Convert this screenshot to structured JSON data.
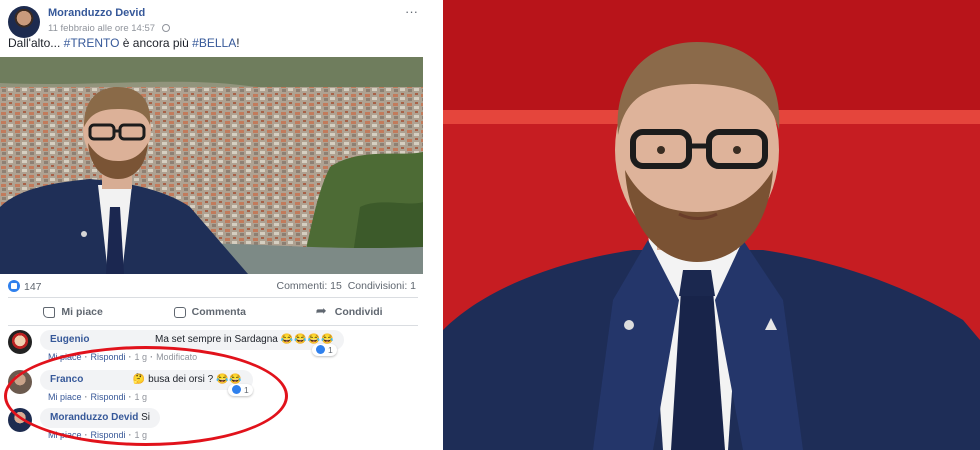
{
  "post": {
    "author": "Moranduzzo Devid",
    "timestamp": "11 febbraio alle ore 14:57",
    "more_icon": "···",
    "text_prefix": "Dall'alto... ",
    "tag_trento": "#TRENTO",
    "text_middle": " è ancora più ",
    "tag_bella": "#BELLA",
    "text_suffix": "!",
    "reactions_count": "147",
    "comments_count": "Commenti: 15",
    "shares_count": "Condivisioni: 1",
    "actions": {
      "like": "Mi piace",
      "comment": "Commenta",
      "share": "Condividi"
    }
  },
  "comments": [
    {
      "name": "Eugenio",
      "text": "Ma set sempre in Sardagna",
      "emojis": "😂😂😂😂",
      "like_label": "Mi piace",
      "reply_label": "Rispondi",
      "time": "1 g",
      "edit_label": "Modificato",
      "reaction_count": "1"
    },
    {
      "name": "Franco",
      "text": "busa dei orsi ?",
      "emoji_prefix": "🤔",
      "emojis": "😂😂",
      "like_label": "Mi piace",
      "reply_label": "Rispondi",
      "time": "1 g",
      "reaction_count": "1"
    },
    {
      "name": "Moranduzzo Devid",
      "text": "Si",
      "like_label": "Mi piace",
      "reply_label": "Rispondi",
      "time": "1 g"
    }
  ],
  "icons": {
    "globe": "globe-icon",
    "like": "thumbs-up-icon",
    "comment": "speech-bubble-icon",
    "share": "share-arrow-icon"
  },
  "colors": {
    "link_blue": "#365899",
    "reaction_blue": "#2f80ed",
    "highlight_red": "#e1121b",
    "backdrop_red": "#c4161c"
  }
}
